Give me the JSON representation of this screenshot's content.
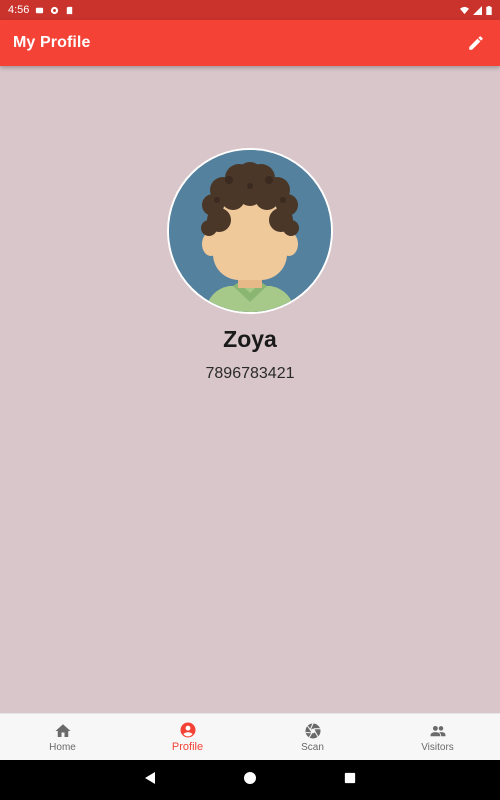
{
  "status_bar": {
    "time": "4:56",
    "icons": [
      "sim-card-icon",
      "location-sync-icon",
      "sd-card-icon",
      "wifi-icon",
      "signal-icon",
      "battery-icon"
    ]
  },
  "app_bar": {
    "title": "My Profile",
    "action_icon": "edit-icon"
  },
  "profile": {
    "name": "Zoya",
    "phone": "7896783421",
    "avatar_icon": "avatar-illustration"
  },
  "bottom_nav": {
    "items": [
      {
        "label": "Home",
        "icon": "home-icon",
        "active": false
      },
      {
        "label": "Profile",
        "icon": "account-circle-icon",
        "active": true
      },
      {
        "label": "Scan",
        "icon": "camera-shutter-icon",
        "active": false
      },
      {
        "label": "Visitors",
        "icon": "people-icon",
        "active": false
      }
    ]
  },
  "system_nav": {
    "buttons": [
      "back-icon",
      "home-circle-icon",
      "recents-icon"
    ]
  },
  "colors": {
    "status_bar": "#c9332c",
    "app_bar": "#f44336",
    "background": "#d8c6cb",
    "active_nav": "#f44336",
    "avatar_bg": "#54819e"
  }
}
